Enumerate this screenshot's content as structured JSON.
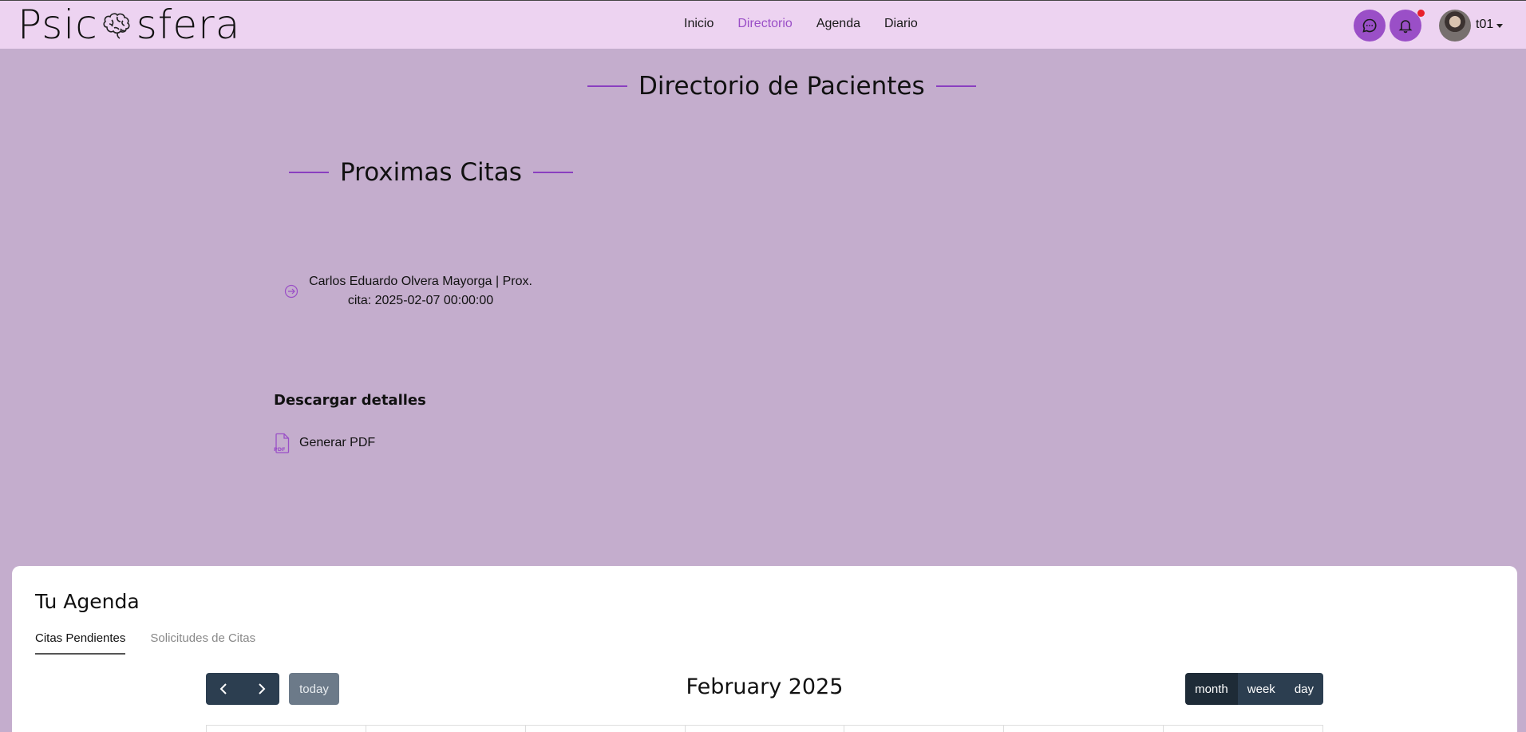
{
  "brand": {
    "name_left": "Psic",
    "name_right": "sfera"
  },
  "nav": {
    "items": [
      {
        "label": "Inicio",
        "active": false
      },
      {
        "label": "Directorio",
        "active": true
      },
      {
        "label": "Agenda",
        "active": false
      },
      {
        "label": "Diario",
        "active": false
      }
    ]
  },
  "user": {
    "name": "t01"
  },
  "page": {
    "title": "Directorio de Pacientes"
  },
  "upcoming": {
    "title": "Proximas Citas",
    "appointment_line1": "Carlos Eduardo Olvera Mayorga | Prox.",
    "appointment_line2": "cita: 2025-02-07 00:00:00"
  },
  "download": {
    "title": "Descargar detalles",
    "pdf_label": "Generar PDF",
    "pdf_badge": "PDF"
  },
  "agenda": {
    "title": "Tu Agenda",
    "tabs": [
      {
        "label": "Citas Pendientes",
        "active": true
      },
      {
        "label": "Solicitudes de Citas",
        "active": false
      }
    ],
    "today_label": "today",
    "month_title": "February 2025",
    "views": [
      {
        "label": "month",
        "active": true
      },
      {
        "label": "week",
        "active": false
      },
      {
        "label": "day",
        "active": false
      }
    ]
  },
  "colors": {
    "accent": "#9a4fc7",
    "page_bg": "#c4adcd",
    "nav_bg": "#edd3f1",
    "notification_dot": "#e8202a"
  }
}
